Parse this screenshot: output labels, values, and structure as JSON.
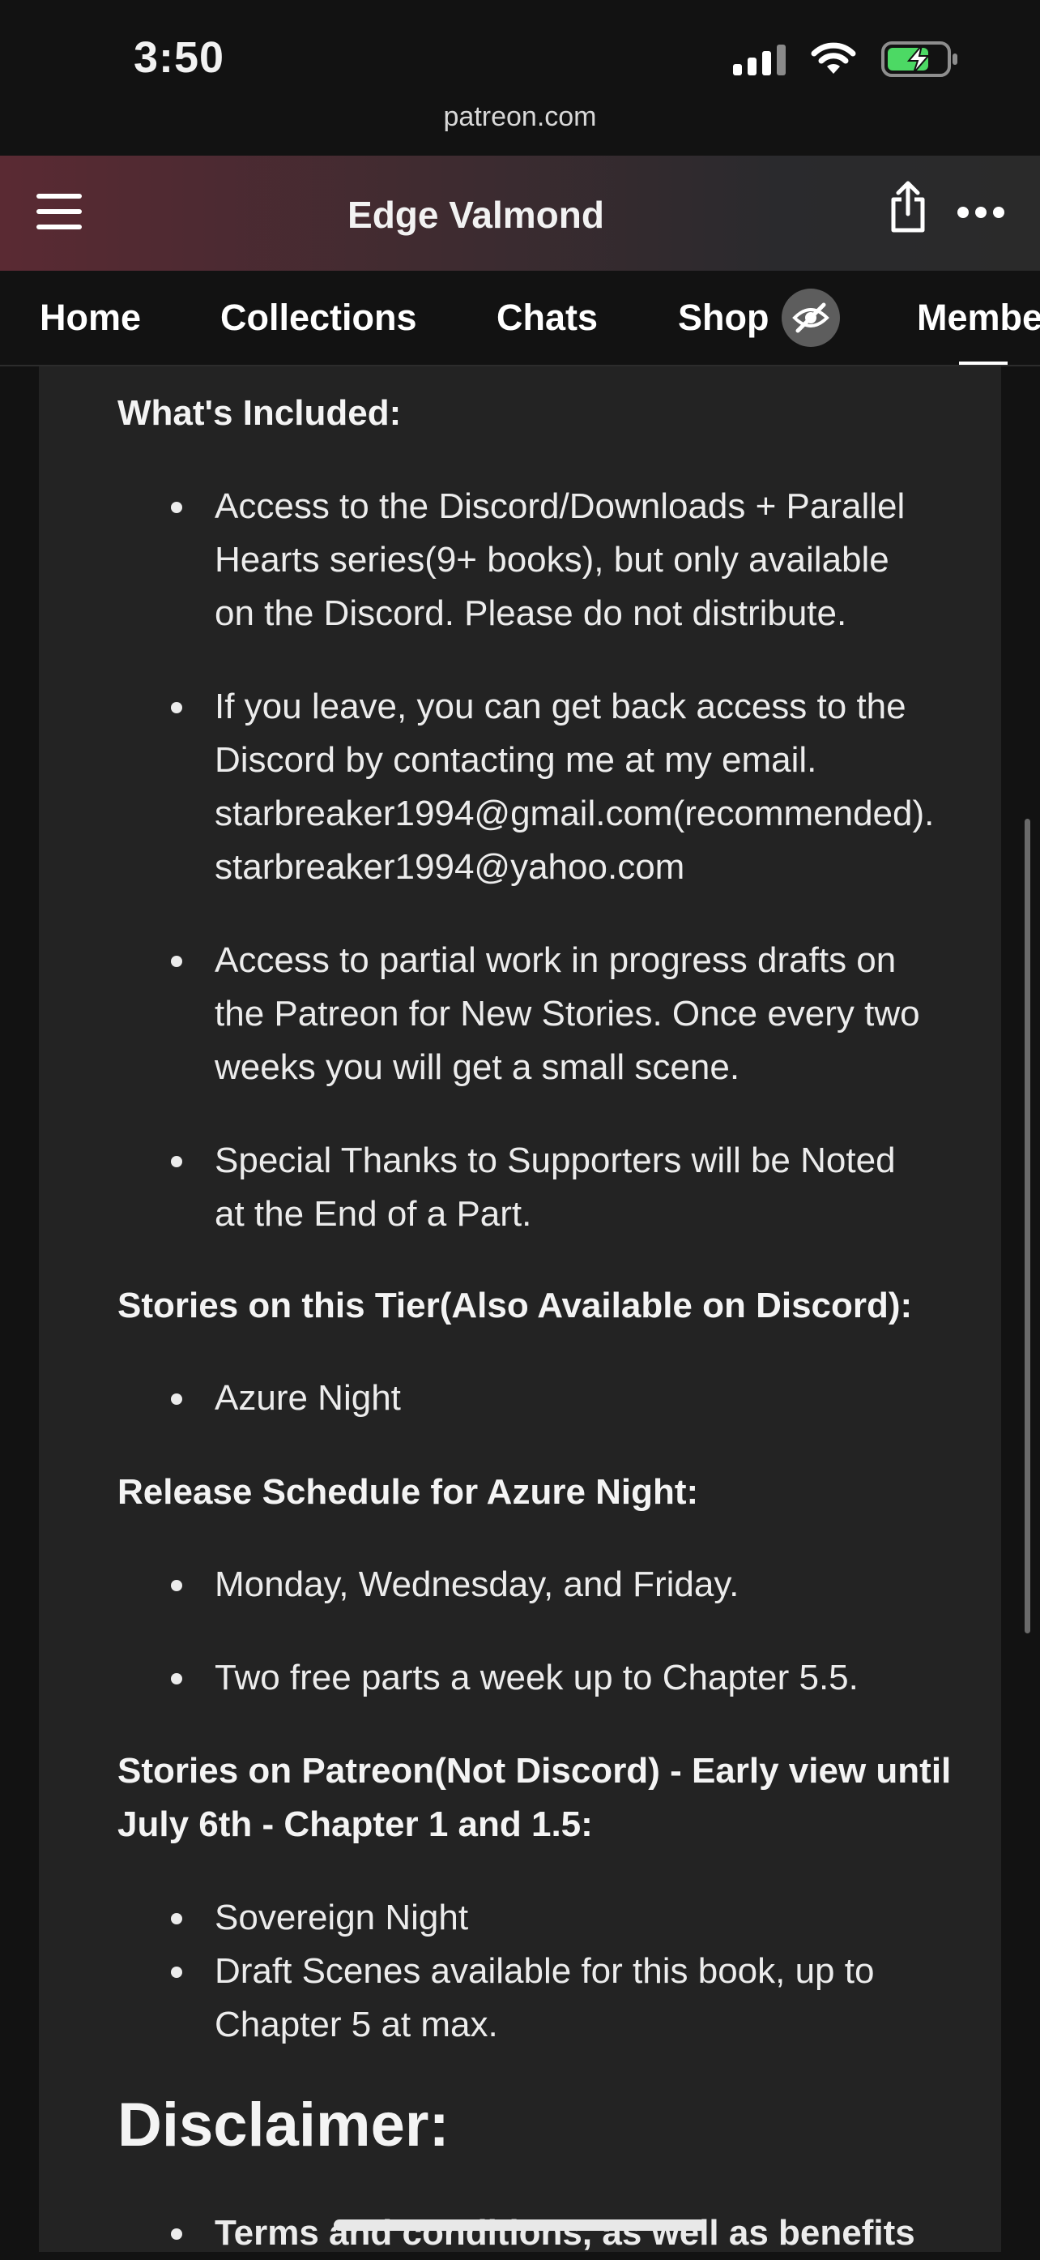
{
  "status_bar": {
    "time": "3:50"
  },
  "browser": {
    "url": "patreon.com"
  },
  "header": {
    "title": "Edge Valmond"
  },
  "tabs": [
    {
      "label": "Home"
    },
    {
      "label": "Collections"
    },
    {
      "label": "Chats"
    },
    {
      "label": "Shop"
    },
    {
      "label": "Members"
    }
  ],
  "content": {
    "whats_included_heading": "What's Included:",
    "whats_included": [
      [
        "Access to the Discord/Downloads + Parallel",
        "Hearts series(9+ books), but only available",
        "on the Discord. Please do not distribute."
      ],
      [
        "If you leave, you can get back access to the",
        "Discord by contacting me at my email.",
        "starbreaker1994@gmail.com(recommended).",
        "starbreaker1994@yahoo.com"
      ],
      [
        "Access to partial work in progress drafts on",
        "the Patreon for New Stories. Once every two",
        "weeks you will get a small scene."
      ],
      [
        "Special Thanks to Supporters will be Noted",
        "at the End of a Part."
      ]
    ],
    "stories_tier_heading": "Stories on this Tier(Also Available on Discord):",
    "stories_tier": [
      "Azure Night"
    ],
    "release_heading": "Release Schedule for Azure Night:",
    "release": [
      "Monday, Wednesday, and Friday.",
      "Two free parts a week up to Chapter 5.5."
    ],
    "patreon_heading_line1": "Stories on Patreon(Not Discord) - Early view until",
    "patreon_heading_line2": "July 6th - Chapter 1 and 1.5:",
    "patreon_stories": [
      [
        "Sovereign Night"
      ],
      [
        "Draft Scenes available for this book, up to",
        "Chapter 5 at max."
      ]
    ],
    "disclaimer_title": "Disclaimer:",
    "disclaimer_first": "Terms and conditions, as well as benefits"
  },
  "colors": {
    "header_accent": "#5a2a33",
    "card_bg": "#232323",
    "page_bg": "#121212"
  }
}
